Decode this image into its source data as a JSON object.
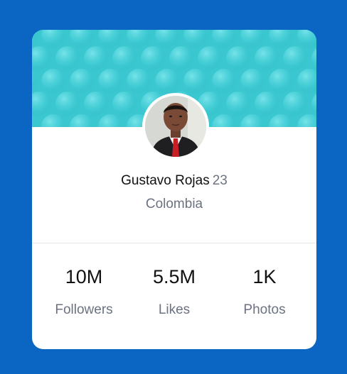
{
  "colors": {
    "page_background": "#0a66c2",
    "banner": "#3cc9d2",
    "card": "#ffffff",
    "muted_text": "#6b7280"
  },
  "profile": {
    "name": "Gustavo Rojas",
    "age": "23",
    "location": "Colombia",
    "avatar_icon": "user-photo"
  },
  "stats": [
    {
      "value": "10M",
      "label": "Followers"
    },
    {
      "value": "5.5M",
      "label": "Likes"
    },
    {
      "value": "1K",
      "label": "Photos"
    }
  ]
}
